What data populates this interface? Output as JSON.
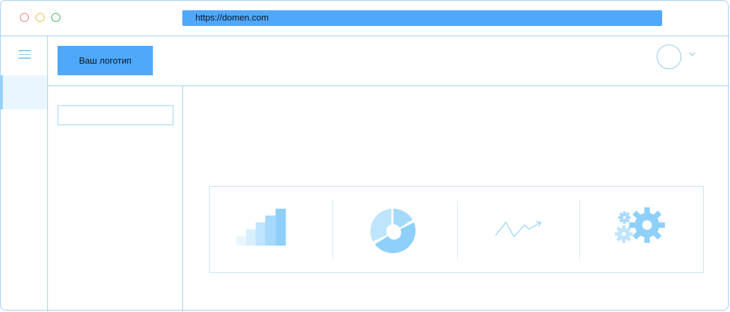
{
  "browser": {
    "url": "https://domen.com"
  },
  "header": {
    "logo_label": "Ваш логотип"
  },
  "sidebar": {
    "menu_icon": "hamburger-icon"
  },
  "search": {
    "placeholder": "",
    "value": ""
  },
  "dashboard": {
    "tiles": [
      {
        "icon": "bar-chart-icon"
      },
      {
        "icon": "donut-chart-icon"
      },
      {
        "icon": "trend-line-icon"
      },
      {
        "icon": "gears-icon"
      }
    ]
  },
  "colors": {
    "accent": "#50a8fb",
    "border": "#9fd2f5",
    "icon_light": "#bfe4fd",
    "icon_mid": "#8fd0fb"
  }
}
